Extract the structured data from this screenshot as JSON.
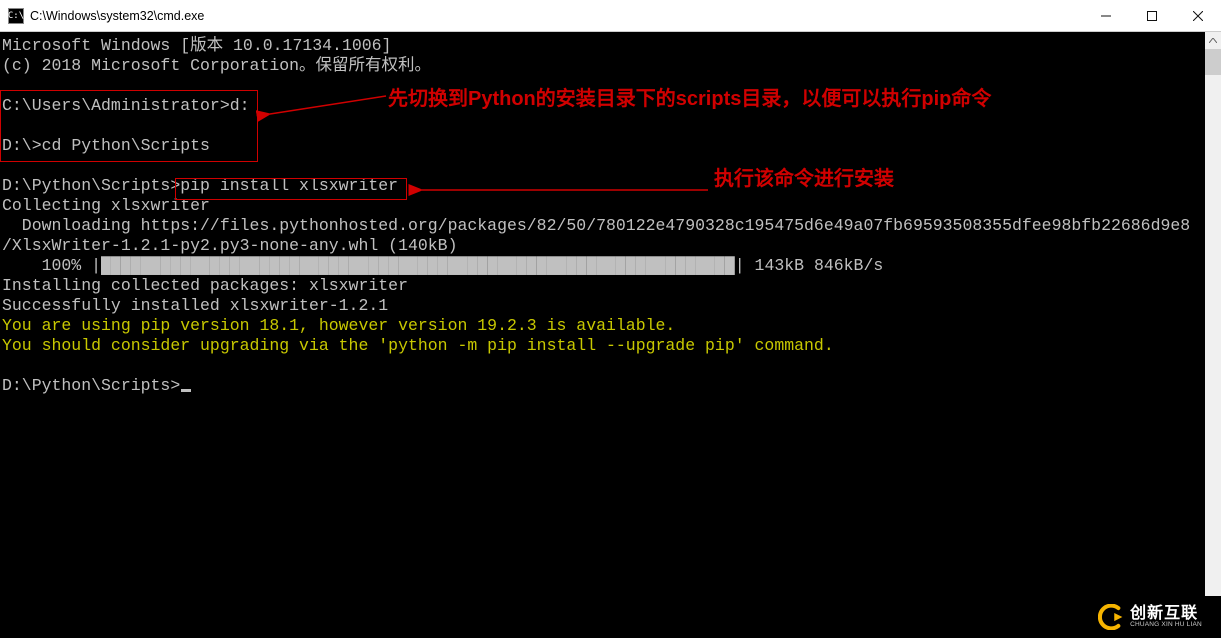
{
  "window": {
    "title": "C:\\Windows\\system32\\cmd.exe"
  },
  "terminal": {
    "line1": "Microsoft Windows [版本 10.0.17134.1006]",
    "line2": "(c) 2018 Microsoft Corporation。保留所有权利。",
    "prompt1": "C:\\Users\\Administrator>",
    "cmd1": "d:",
    "prompt2": "D:\\>",
    "cmd2": "cd Python\\Scripts",
    "prompt3": "D:\\Python\\Scripts>",
    "cmd3": "pip install xlsxwriter",
    "collecting": "Collecting xlsxwriter",
    "download1": "  Downloading https://files.pythonhosted.org/packages/82/50/780122e4790328c195475d6e49a07fb69593508355dfee98bfb22686d9e8",
    "download2": "/XlsxWriter-1.2.1-py2.py3-none-any.whl (140kB)",
    "progress_pct": "    100% |",
    "progress_bar": "████████████████████████████████████████████████████████████████",
    "progress_suffix": "| 143kB 846kB/s",
    "installing": "Installing collected packages: xlsxwriter",
    "success": "Successfully installed xlsxwriter-1.2.1",
    "warn1": "You are using pip version 18.1, however version 19.2.3 is available.",
    "warn2": "You should consider upgrading via the 'python -m pip install --upgrade pip' command.",
    "prompt4": "D:\\Python\\Scripts>"
  },
  "annotations": {
    "note1": "先切换到Python的安装目录下的scripts目录，以便可以执行pip命令",
    "note2": "执行该命令进行安装"
  },
  "watermark": {
    "cn": "创新互联",
    "en": "CHUANG XIN HU LIAN"
  }
}
